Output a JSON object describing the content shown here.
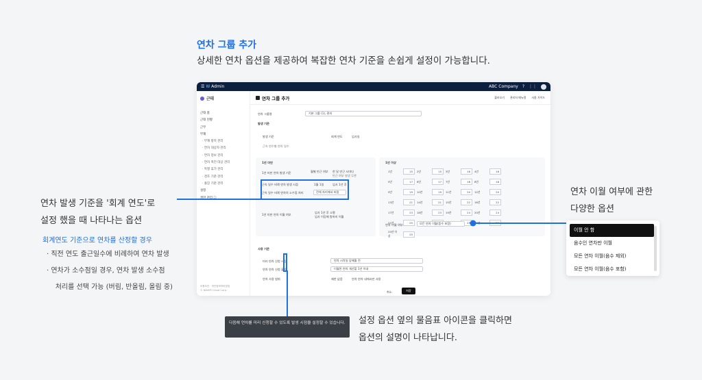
{
  "hero": {
    "title": "연차 그룹 추가",
    "subtitle": "상세한 연차 옵션을 제공하여 복잡한 연차 기준을 손쉽게 설정이 가능합니다."
  },
  "app": {
    "name": "Admin",
    "company": "ABC Company",
    "help": "?",
    "brand": "근태"
  },
  "sidebar": {
    "items": [
      "근태 홈",
      "근태 현황",
      "근무",
      "부재",
      "· 부재 항목 관리",
      "· 연차 대상자 관리",
      "· 연차 정보 관리",
      "· 연차 촉진 대상 관리",
      "· 특별 휴가 관리",
      "· 경조 기준 관리",
      "· 출장 기준 관리",
      "설정",
      "권한 관리 ☐"
    ],
    "footer": [
      "이용조건 · 개인정보처리방침",
      "© NAVER Cloud Corp."
    ]
  },
  "page": {
    "title": "연차 그룹 추가",
    "actions": [
      "불러오기",
      "관리자 매뉴얼",
      "사용 가이드"
    ]
  },
  "form": {
    "group_name_label": "연차 그룹명",
    "group_name_value": "기본 그룹 (1), 관리",
    "basic_label": "발생 기준",
    "basis_label": "발생 기준",
    "basis_opt1": "회계 연도",
    "basis_opt2": "입사일",
    "note": "근속 연수별 연차 일수",
    "sec1": "1년 미만",
    "sec1_row1": "1년 미만 연차 발생 기준",
    "sec1_row1_opt1": "월별 만근 여부",
    "sec1_row1_opt2": "한 달 만근 시마다",
    "sec1_row1_opt3": "만근 여부 발생 무관",
    "sec1_row2": "근속 일수 비례 연차 발생 시점",
    "sec1_row2_opt1": "1월 1일",
    "sec1_row2_opt2": "입사 1년 후",
    "sec1_row3": "근속 일수 비례 연차의 소수점 처리",
    "sec1_row3_val": "전체 자리에서 버림",
    "sec1_row4": "1년 미만 연차 이월 여부",
    "sec1_row4_opt1": "입사 1년 후 소멸",
    "sec1_row4_opt2": "입사 이듬해 말까지 이월",
    "sec2": "1년 이상",
    "carry_label": "연차 이월 여부",
    "carry_value": "모든 연차 이월(음수 포함)",
    "extra_label": "사용 기준",
    "extra_row1": "미리 연차 신청 시점",
    "extra_row1_val": "연차 시작일 당해월 전",
    "extra_row2": "연차 연차 신청 불가",
    "extra_row2_val": "이월된 연차 개선할 1년 이내",
    "extra_row3": "연차 사용 범위",
    "extra_row3_opt1": "제한 없음",
    "extra_row3_opt2": "연차 연차 내에서만 사용",
    "cancel": "취소",
    "save": "저장"
  },
  "years": [
    [
      "1년",
      "15"
    ],
    [
      "2년",
      "15"
    ],
    [
      "3년",
      "16"
    ],
    [
      "4년",
      "16"
    ],
    [
      "5년",
      "17"
    ],
    [
      "6년",
      "17"
    ],
    [
      "7년",
      "18"
    ],
    [
      "8년",
      "18"
    ],
    [
      "9년",
      "19"
    ],
    [
      "10년",
      "19"
    ],
    [
      "11년",
      "20"
    ],
    [
      "12년",
      "20"
    ],
    [
      "13년",
      "21"
    ],
    [
      "14년",
      "21"
    ],
    [
      "15년",
      "22"
    ],
    [
      "16년",
      "22"
    ],
    [
      "17년",
      "23"
    ],
    [
      "18년",
      "23"
    ],
    [
      "19년",
      "24"
    ],
    [
      "20년",
      "24"
    ],
    [
      "21년",
      "25"
    ],
    [
      "22년",
      "25"
    ],
    [
      "23년",
      "25"
    ],
    [
      "24년",
      "25"
    ],
    [
      "25년 이상",
      "25"
    ]
  ],
  "annotations": {
    "left": [
      "연차 발생 기준을 '회계 연도'로",
      "설정 했을 때  나타나는 옵션"
    ],
    "left_blue": "회계연도 기준으로 연차를 산정할 경우",
    "left_list": [
      "·  직전 연도 출근일수에 비례하여 연차 발생",
      "·  연차가 소수점일 경우, 연차 발생 소수점",
      "    처리를 선택 가능 (버림, 반올림, 올림 중)"
    ],
    "right": [
      "연차 이월 여부에 관한",
      "다양한 옵션"
    ],
    "dropdown": [
      "이월 안 함",
      "음수인 연차만 이월",
      "모든 연차 이월(음수 제외)",
      "모든 연차 이월(음수 포함)"
    ],
    "tooltip": "다음해 연차를 미리 신청할 수 있도록 발생 시점을 설정할 수 있습니다.",
    "bottom": [
      "설정 옵션 옆의 물음표 아이콘을 클릭하면",
      "옵션의 설명이 나타납니다."
    ]
  },
  "colors": {
    "accent": "#1e6fe0",
    "topbar": "#0d1f3f"
  }
}
